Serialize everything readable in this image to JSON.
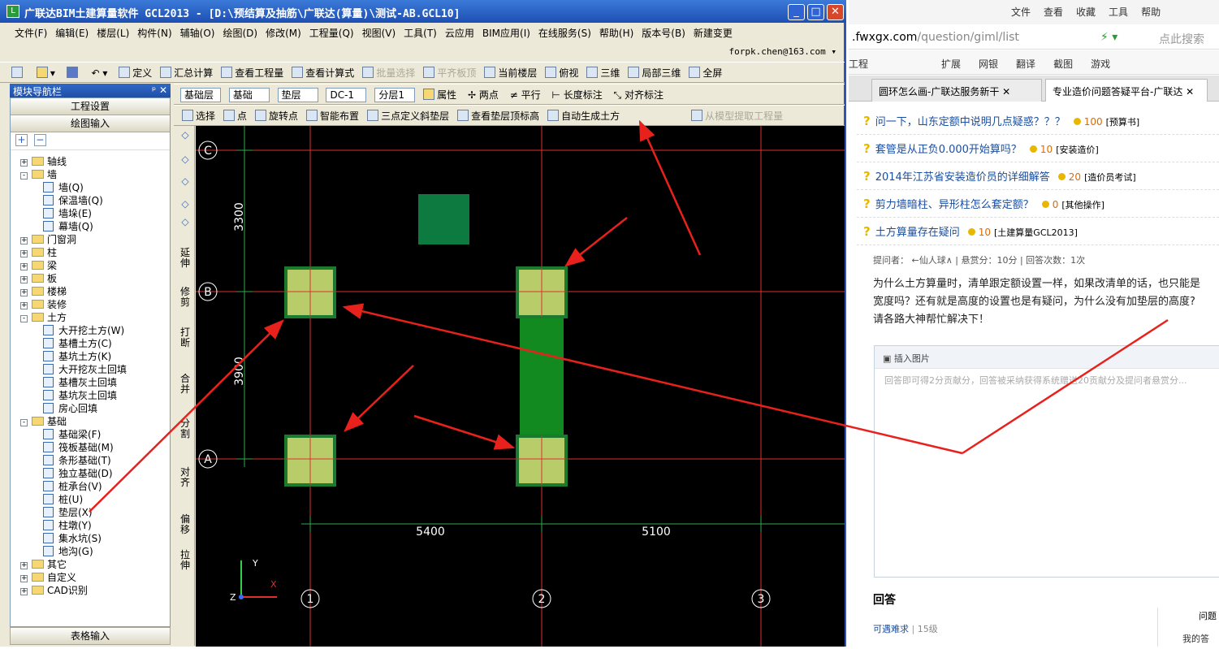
{
  "app": {
    "title": "广联达BIM土建算量软件 GCL2013 - [D:\\预结算及抽筋\\广联达(算量)\\测试-AB.GCL10]",
    "menu": [
      "文件(F)",
      "编辑(E)",
      "楼层(L)",
      "构件(N)",
      "辅轴(O)",
      "绘图(D)",
      "修改(M)",
      "工程量(Q)",
      "视图(V)",
      "工具(T)",
      "云应用",
      "BIM应用(I)",
      "在线服务(S)",
      "帮助(H)",
      "版本号(B)",
      "新建变更"
    ],
    "user": "forpk.chen@163.com",
    "toolbar1": [
      "定义",
      "汇总计算",
      "查看工程量",
      "查看计算式",
      "批量选择",
      "平齐板顶",
      "当前楼层",
      "俯视",
      "三维",
      "局部三维",
      "全屏"
    ],
    "toolbar2": {
      "floor": "基础层",
      "cat": "基础",
      "type": "垫层",
      "code": "DC-1",
      "layer": "分层1",
      "props": "属性",
      "twopoint": "两点",
      "parallel": "平行",
      "dim": "长度标注",
      "align": "对齐标注"
    },
    "toolbar3": [
      "选择",
      "点",
      "旋转点",
      "智能布置",
      "三点定义斜垫层",
      "查看垫层顶标高",
      "自动生成土方",
      "从模型提取工程量"
    ]
  },
  "nav": {
    "title": "模块导航栏",
    "project": "工程设置",
    "drawing": "绘图输入",
    "table": "表格输入",
    "tree": [
      {
        "label": "轴线",
        "level": 0,
        "exp": "+"
      },
      {
        "label": "墙",
        "level": 0,
        "exp": "-"
      },
      {
        "label": "墙(Q)",
        "level": 1
      },
      {
        "label": "保温墙(Q)",
        "level": 1
      },
      {
        "label": "墙垛(E)",
        "level": 1
      },
      {
        "label": "幕墙(Q)",
        "level": 1
      },
      {
        "label": "门窗洞",
        "level": 0,
        "exp": "+"
      },
      {
        "label": "柱",
        "level": 0,
        "exp": "+"
      },
      {
        "label": "梁",
        "level": 0,
        "exp": "+"
      },
      {
        "label": "板",
        "level": 0,
        "exp": "+"
      },
      {
        "label": "楼梯",
        "level": 0,
        "exp": "+"
      },
      {
        "label": "装修",
        "level": 0,
        "exp": "+"
      },
      {
        "label": "土方",
        "level": 0,
        "exp": "-"
      },
      {
        "label": "大开挖土方(W)",
        "level": 1
      },
      {
        "label": "基槽土方(C)",
        "level": 1
      },
      {
        "label": "基坑土方(K)",
        "level": 1
      },
      {
        "label": "大开挖灰土回填",
        "level": 1
      },
      {
        "label": "基槽灰土回填",
        "level": 1
      },
      {
        "label": "基坑灰土回填",
        "level": 1
      },
      {
        "label": "房心回填",
        "level": 1
      },
      {
        "label": "基础",
        "level": 0,
        "exp": "-"
      },
      {
        "label": "基础梁(F)",
        "level": 1
      },
      {
        "label": "筏板基础(M)",
        "level": 1
      },
      {
        "label": "条形基础(T)",
        "level": 1
      },
      {
        "label": "独立基础(D)",
        "level": 1
      },
      {
        "label": "桩承台(V)",
        "level": 1
      },
      {
        "label": "桩(U)",
        "level": 1
      },
      {
        "label": "垫层(X)",
        "level": 1
      },
      {
        "label": "柱墩(Y)",
        "level": 1
      },
      {
        "label": "集水坑(S)",
        "level": 1
      },
      {
        "label": "地沟(G)",
        "level": 1
      },
      {
        "label": "其它",
        "level": 0,
        "exp": "+"
      },
      {
        "label": "自定义",
        "level": 0,
        "exp": "+"
      },
      {
        "label": "CAD识别",
        "level": 0,
        "exp": "+"
      }
    ]
  },
  "vtools": [
    "延伸",
    "修剪",
    "打断",
    "合并",
    "分割",
    "对齐",
    "偏移",
    "拉伸"
  ],
  "canvas": {
    "axes_h": [
      "C",
      "B",
      "A"
    ],
    "axes_v": [
      "1",
      "2",
      "3"
    ],
    "dims_v": [
      "3300",
      "3900"
    ],
    "dims_h": [
      "5400",
      "5100"
    ],
    "coord_y": "Y",
    "coord_x": "X",
    "coord_z": "Z",
    "colors": {
      "grid": "#e0302e",
      "dimline": "#2fa84a",
      "pad": "#b8cc6a",
      "padborder": "#1c7a2e",
      "beam": "#138a1f",
      "dark": "#0d7a40",
      "arrow": "#e8211c"
    }
  },
  "browser": {
    "menu": [
      "文件",
      "查看",
      "收藏",
      "工具",
      "帮助"
    ],
    "url_host": ".fwxgx.com",
    "url_path": "/question/giml/list",
    "search_placeholder": "点此搜索",
    "favs": [
      "扩展",
      "网银",
      "翻译",
      "截图",
      "游戏"
    ],
    "fav_left": "工程",
    "tab1": "圆环怎么画-广联达服务新干",
    "tab2": "专业造价问题答疑平台-广联达",
    "questions": [
      {
        "title": "问一下，山东定额中说明几点疑惑？？？",
        "score": "100",
        "tag": "[预算书]"
      },
      {
        "title": "套管是从正负0.000开始算吗？",
        "score": "10",
        "tag": "[安装造价]"
      },
      {
        "title": "2014年江苏省安装造价员的详细解答",
        "score": "20",
        "tag": "[造价员考试]"
      },
      {
        "title": "剪力墙暗柱、异形柱怎么套定额？",
        "score": "0",
        "tag": "[其他操作]"
      },
      {
        "title": "土方算量存在疑问",
        "score": "10",
        "tag": "[土建算量GCL2013]"
      }
    ],
    "meta": "提问者： ←仙人球∧ | 悬赏分：10分 | 回答次数：1次",
    "body": [
      "为什么土方算量时，清单跟定额设置一样，如果改清单的话，也只能是",
      "宽度吗？还有就是高度的设置也是有疑问，为什么没有加垫层的高度?",
      "请各路大神帮忙解决下！"
    ],
    "insert_image": "插入图片",
    "editor_placeholder": "回答即可得2分贡献分，回答被采纳获得系统赠送20贡献分及提问者悬赏分...",
    "answer_title": "回答",
    "answerer": "可遇难求",
    "answerer_level": "15级",
    "side1": "问题",
    "side2": "我的答"
  }
}
